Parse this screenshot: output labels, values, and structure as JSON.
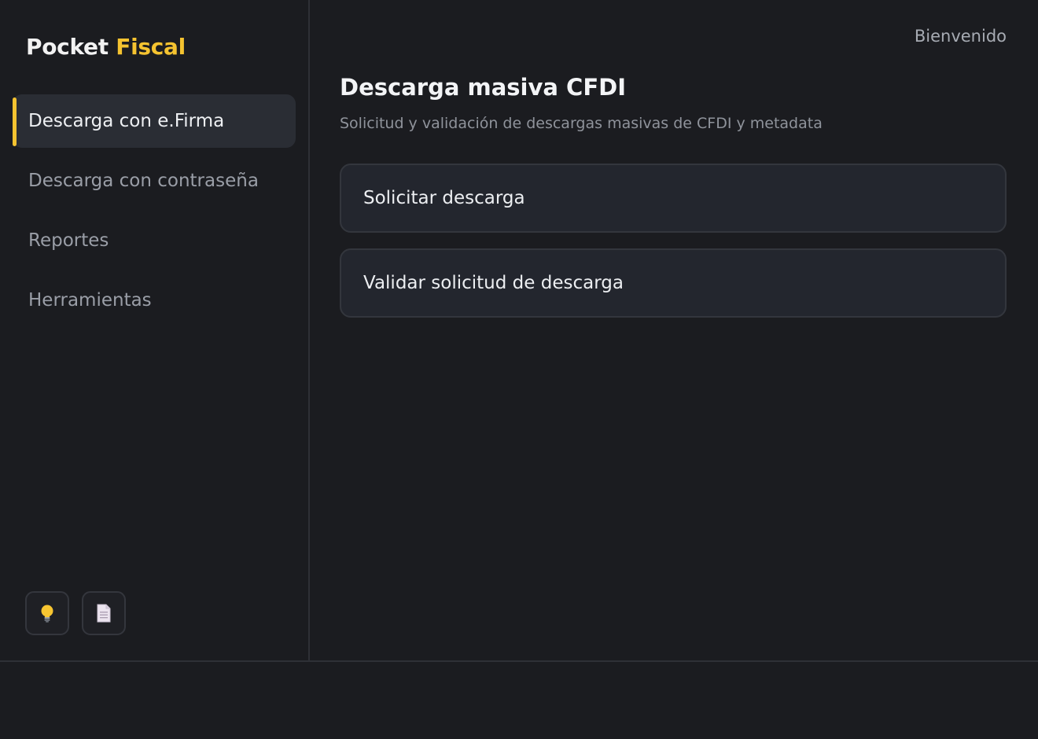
{
  "brand": {
    "primary": "Pocket",
    "accent": "Fiscal",
    "accent_color": "#f5c330"
  },
  "sidebar": {
    "items": [
      {
        "label": "Descarga con e.Firma",
        "active": true
      },
      {
        "label": "Descarga con contraseña",
        "active": false
      },
      {
        "label": "Reportes",
        "active": false
      },
      {
        "label": "Herramientas",
        "active": false
      }
    ],
    "buttons": [
      {
        "icon": "lightbulb-icon"
      },
      {
        "icon": "document-icon"
      }
    ]
  },
  "header": {
    "welcome": "Bienvenido"
  },
  "main": {
    "title": "Descarga masiva CFDI",
    "subtitle": "Solicitud y validación de descargas masivas de CFDI y metadata",
    "actions": [
      {
        "label": "Solicitar descarga"
      },
      {
        "label": "Validar solicitud de descarga"
      }
    ]
  }
}
